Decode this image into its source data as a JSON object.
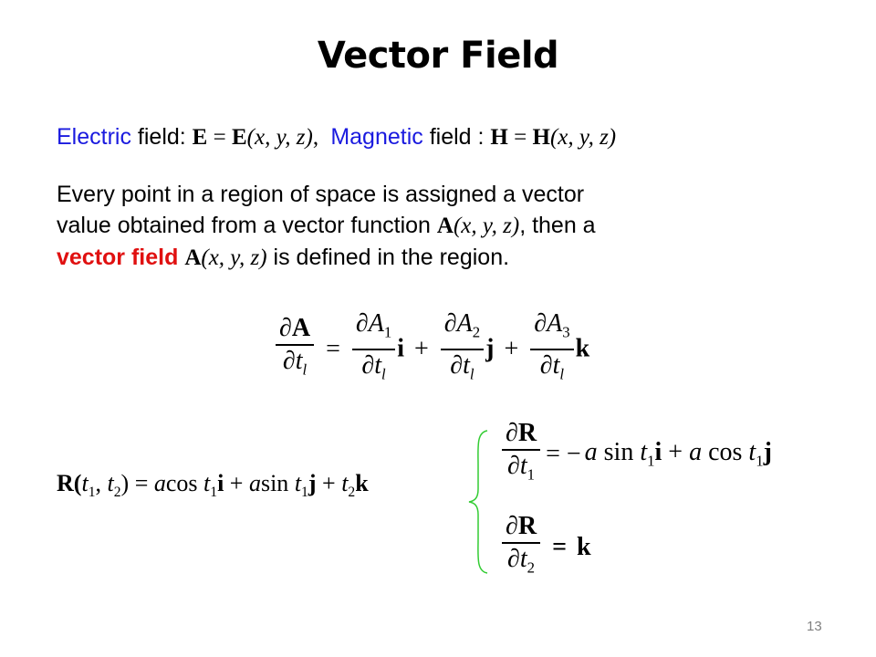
{
  "slide": {
    "title": "Vector Field",
    "page_number": "13",
    "colors": {
      "blue": "#1a1adf",
      "red": "#e01010",
      "brace": "#33cc33",
      "page_number": "#808080"
    }
  },
  "line1": {
    "electric_word": "Electric",
    "electric_rest": " field: ",
    "electric_eq": {
      "lhs": "E",
      "eq": " = ",
      "rhs": "E",
      "args": "(x, y, z)",
      "comma": ", "
    },
    "magnetic_word": "Magnetic",
    "magnetic_rest": " field : ",
    "magnetic_eq": {
      "lhs": "H",
      "eq": " = ",
      "rhs": "H",
      "args": "(x, y, z)"
    }
  },
  "paragraph": {
    "line1": "Every point in a region of space is assigned a vector",
    "line2_pre": "value obtained from a vector function ",
    "line2_vec": "A",
    "line2_args": "(x, y, z)",
    "line2_post": ", then a",
    "line3_highlight": "vector field",
    "line3_vec": "A",
    "line3_args": "(x, y, z)",
    "line3_post": " is defined in the region."
  },
  "equation_partial": {
    "lhs_num": "∂A",
    "lhs_den": "∂t",
    "eq": "=",
    "terms": [
      {
        "num": "∂A",
        "num_sub": "1",
        "den": "∂t",
        "den_sub": "l",
        "unit": "i"
      },
      {
        "num": "∂A",
        "num_sub": "2",
        "den": "∂t",
        "den_sub": "l",
        "unit": "j"
      },
      {
        "num": "∂A",
        "num_sub": "3",
        "den": "∂t",
        "den_sub": "l",
        "unit": "k"
      }
    ],
    "lhs_den_sub": "l",
    "plus": "+"
  },
  "equation_R": {
    "lhs": "R",
    "open": "(",
    "t": "t",
    "s1": "1",
    "sep": ", ",
    "s2": "2",
    "close": ")",
    "rhs_parts": [
      " = ",
      "a",
      "cos ",
      "t",
      "1",
      "i",
      " + ",
      "a",
      "sin ",
      "t",
      "1",
      "j",
      " + ",
      "t",
      "2",
      "k"
    ]
  },
  "equation_dR1": {
    "num": "∂R",
    "den": "∂t",
    "den_sub": "1",
    "rhs": {
      "eq": "= −",
      "a1": "a",
      "sin": " sin ",
      "t1": "t",
      "s1": "1",
      "i": "i",
      "plus": " + ",
      "a2": "a",
      "cos": " cos ",
      "t2": "t",
      "s2": "1",
      "j": "j"
    }
  },
  "equation_dR2": {
    "num": "∂R",
    "den": "∂t",
    "den_sub": "2",
    "rhs": {
      "eq": " = ",
      "k": "k"
    }
  }
}
